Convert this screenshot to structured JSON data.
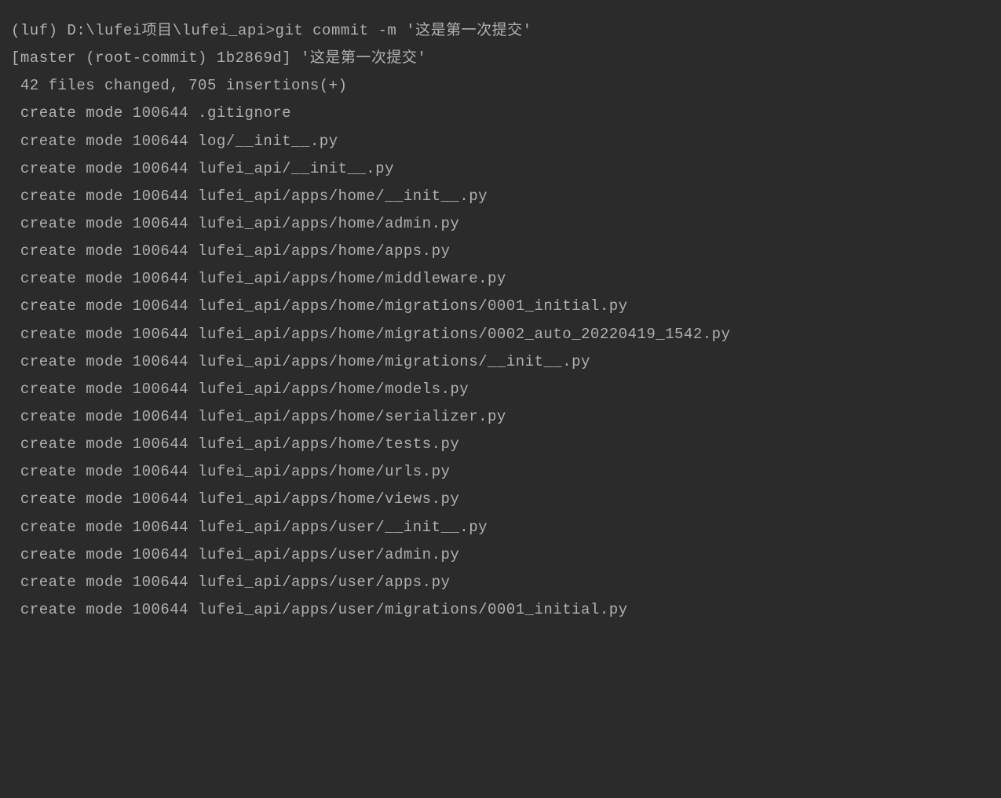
{
  "terminal": {
    "prompt": "(luf) D:\\lufei项目\\lufei_api>",
    "command": "git commit -m '这是第一次提交'",
    "commit_info": "[master (root-commit) 1b2869d] '这是第一次提交'",
    "stats": " 42 files changed, 705 insertions(+)",
    "files": [
      " create mode 100644 .gitignore",
      " create mode 100644 log/__init__.py",
      " create mode 100644 lufei_api/__init__.py",
      " create mode 100644 lufei_api/apps/home/__init__.py",
      " create mode 100644 lufei_api/apps/home/admin.py",
      " create mode 100644 lufei_api/apps/home/apps.py",
      " create mode 100644 lufei_api/apps/home/middleware.py",
      " create mode 100644 lufei_api/apps/home/migrations/0001_initial.py",
      " create mode 100644 lufei_api/apps/home/migrations/0002_auto_20220419_1542.py",
      " create mode 100644 lufei_api/apps/home/migrations/__init__.py",
      " create mode 100644 lufei_api/apps/home/models.py",
      " create mode 100644 lufei_api/apps/home/serializer.py",
      " create mode 100644 lufei_api/apps/home/tests.py",
      " create mode 100644 lufei_api/apps/home/urls.py",
      " create mode 100644 lufei_api/apps/home/views.py",
      " create mode 100644 lufei_api/apps/user/__init__.py",
      " create mode 100644 lufei_api/apps/user/admin.py",
      " create mode 100644 lufei_api/apps/user/apps.py",
      " create mode 100644 lufei_api/apps/user/migrations/0001_initial.py"
    ]
  }
}
